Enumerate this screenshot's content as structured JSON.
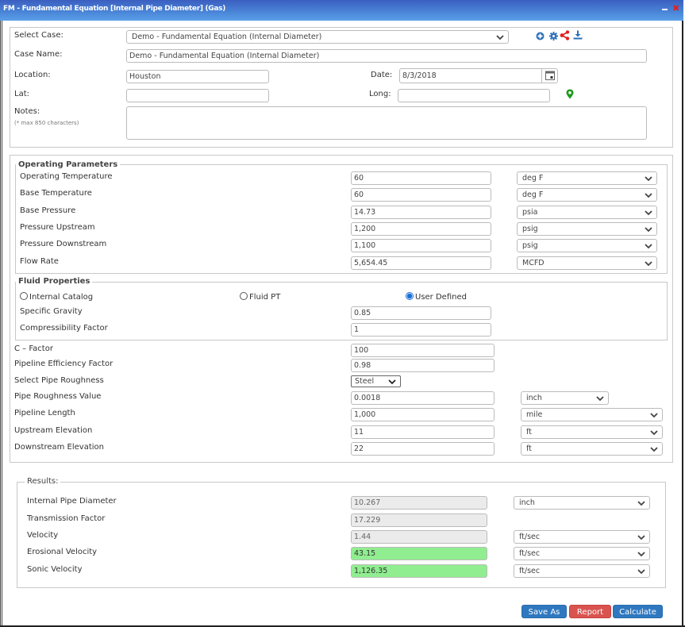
{
  "window": {
    "title": "FM - Fundamental Equation [Internal Pipe Diameter] (Gas)",
    "minimize_icon": "minimize-icon",
    "close_icon": "close-icon"
  },
  "case": {
    "select_case_label": "Select Case:",
    "select_case_value": "Demo - Fundamental Equation (Internal Diameter)",
    "case_name_label": "Case Name:",
    "case_name_value": "Demo - Fundamental Equation (Internal Diameter)",
    "location_label": "Location:",
    "location_value": "Houston",
    "date_label": "Date:",
    "date_value": "8/3/2018",
    "lat_label": "Lat:",
    "lat_value": "",
    "long_label": "Long:",
    "long_value": "",
    "notes_label": "Notes:",
    "notes_hint": "(* max 850 characters)",
    "notes_value": "",
    "toolbar_icons": [
      "add-icon",
      "gear-icon",
      "share-icon",
      "download-icon"
    ],
    "accent_colors": {
      "icons": "#2a6fb8",
      "share": "#e02020",
      "map_pin": "#1f9a1f"
    }
  },
  "operating_parameters": {
    "title": "Operating Parameters",
    "rows": [
      {
        "label": "Operating Temperature",
        "value": "60",
        "unit": "deg F"
      },
      {
        "label": "Base Temperature",
        "value": "60",
        "unit": "deg F"
      },
      {
        "label": "Base Pressure",
        "value": "14.73",
        "unit": "psia"
      },
      {
        "label": "Pressure Upstream",
        "value": "1,200",
        "unit": "psig"
      },
      {
        "label": "Pressure Downstream",
        "value": "1,100",
        "unit": "psig"
      },
      {
        "label": "Flow Rate",
        "value": "5,654.45",
        "unit": "MCFD"
      }
    ]
  },
  "fluid_properties": {
    "title": "Fluid Properties",
    "options": [
      {
        "label": "Internal Catalog",
        "selected": false
      },
      {
        "label": "Fluid PT",
        "selected": false
      },
      {
        "label": "User Defined",
        "selected": true
      }
    ],
    "rows": [
      {
        "label": "Specific Gravity",
        "value": "0.85"
      },
      {
        "label": "Compressibility Factor",
        "value": "1"
      }
    ]
  },
  "pipeline": {
    "c_factor_label": "C – Factor",
    "c_factor_value": "100",
    "efficiency_label": "Pipeline Efficiency Factor",
    "efficiency_value": "0.98",
    "roughness_select_label": "Select Pipe Roughness",
    "roughness_select_value": "Steel",
    "roughness_value_label": "Pipe Roughness Value",
    "roughness_value": "0.0018",
    "roughness_unit": "inch",
    "length_label": "Pipeline Length",
    "length_value": "1,000",
    "length_unit": "mile",
    "upstream_elev_label": "Upstream Elevation",
    "upstream_elev_value": "11",
    "upstream_elev_unit": "ft",
    "downstream_elev_label": "Downstream Elevation",
    "downstream_elev_value": "22",
    "downstream_elev_unit": "ft"
  },
  "results": {
    "title": "Results:",
    "highlight_color": "#90ee90",
    "rows": [
      {
        "label": "Internal Pipe Diameter",
        "value": "10.267",
        "unit": "inch"
      },
      {
        "label": "Transmission Factor",
        "value": "17.229",
        "unit": null
      },
      {
        "label": "Velocity",
        "value": "1.44",
        "unit": "ft/sec"
      },
      {
        "label": "Erosional Velocity",
        "value": "43.15",
        "unit": "ft/sec"
      },
      {
        "label": "Sonic Velocity",
        "value": "1,126.35",
        "unit": "ft/sec"
      }
    ]
  },
  "actions": {
    "save_as": "Save As",
    "report": "Report",
    "calculate": "Calculate"
  }
}
